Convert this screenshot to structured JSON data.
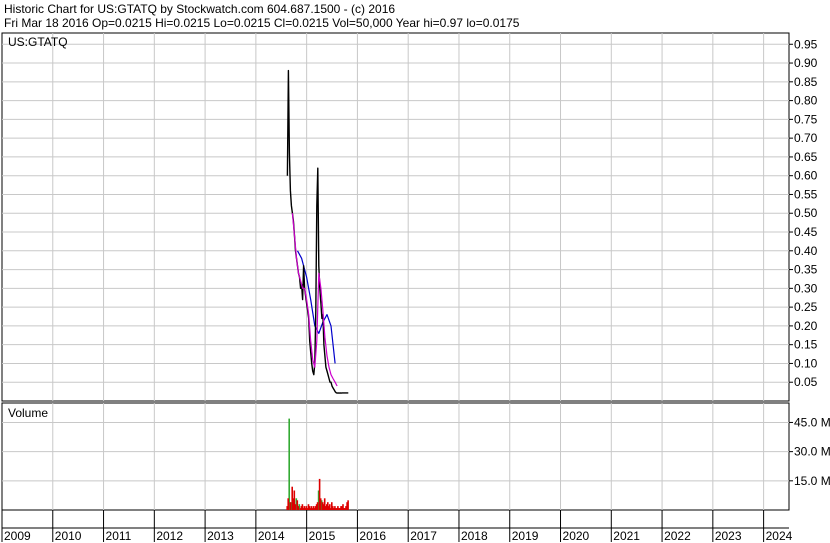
{
  "header": {
    "line1": "Historic Chart for US:GTATQ by Stockwatch.com 604.687.1500 - (c) 2016",
    "line2": "Fri Mar 18 2016   Op=0.0215   Hi=0.0215   Lo=0.0215   Cl=0.0215   Vol=50,000   Year hi=0.97   lo=0.0175"
  },
  "colors": {
    "price": "#000000",
    "ma_short": "#cc00cc",
    "ma_long": "#0000cc",
    "volume_up": "#33aa33",
    "volume_down": "#dd0000",
    "grid": "#c8c8c8",
    "frame": "#000000"
  },
  "chart_data": [
    {
      "type": "line",
      "title": "US:GTATQ",
      "y_ticks": [
        "0.95",
        "0.90",
        "0.85",
        "0.80",
        "0.75",
        "0.70",
        "0.65",
        "0.60",
        "0.55",
        "0.50",
        "0.45",
        "0.40",
        "0.35",
        "0.30",
        "0.25",
        "0.20",
        "0.15",
        "0.10",
        "0.05"
      ],
      "ylim": [
        0,
        0.98
      ],
      "xlim": [
        2009.0,
        2024.5
      ],
      "x_ticks": [
        "2009",
        "2010",
        "2011",
        "2012",
        "2013",
        "2014",
        "2015",
        "2016",
        "2017",
        "2018",
        "2019",
        "2020",
        "2021",
        "2022",
        "2023",
        "2024"
      ],
      "grid": true,
      "series": [
        {
          "key": "price",
          "x": [
            2014.62,
            2014.64,
            2014.66,
            2014.68,
            2014.7,
            2014.72,
            2014.74,
            2014.76,
            2014.78,
            2014.8,
            2014.82,
            2014.84,
            2014.86,
            2014.88,
            2014.9,
            2014.92,
            2014.94,
            2014.96,
            2014.98,
            2015.0,
            2015.02,
            2015.04,
            2015.06,
            2015.08,
            2015.1,
            2015.12,
            2015.14,
            2015.16,
            2015.18,
            2015.2,
            2015.22,
            2015.24,
            2015.26,
            2015.28,
            2015.3,
            2015.32,
            2015.34,
            2015.36,
            2015.38,
            2015.4,
            2015.42,
            2015.44,
            2015.46,
            2015.48,
            2015.5,
            2015.52,
            2015.54,
            2015.56,
            2015.58,
            2015.6,
            2015.62,
            2015.64,
            2015.66,
            2015.68,
            2015.7,
            2015.72,
            2015.74,
            2015.76,
            2015.78,
            2015.8,
            2015.82
          ],
          "y": [
            0.6,
            0.88,
            0.66,
            0.56,
            0.52,
            0.5,
            0.48,
            0.44,
            0.4,
            0.38,
            0.36,
            0.34,
            0.33,
            0.3,
            0.31,
            0.27,
            0.36,
            0.3,
            0.28,
            0.26,
            0.24,
            0.22,
            0.16,
            0.13,
            0.1,
            0.08,
            0.07,
            0.1,
            0.24,
            0.52,
            0.62,
            0.36,
            0.3,
            0.26,
            0.22,
            0.23,
            0.15,
            0.12,
            0.09,
            0.08,
            0.07,
            0.06,
            0.05,
            0.05,
            0.04,
            0.035,
            0.03,
            0.025,
            0.022,
            0.021,
            0.0215,
            0.021,
            0.0215,
            0.021,
            0.0215,
            0.0215,
            0.0215,
            0.0215,
            0.0215,
            0.0215,
            0.0215
          ]
        },
        {
          "key": "ma_short",
          "x": [
            2014.72,
            2014.76,
            2014.8,
            2014.84,
            2014.88,
            2014.92,
            2014.96,
            2015.0,
            2015.04,
            2015.08,
            2015.12,
            2015.16,
            2015.2,
            2015.24,
            2015.28,
            2015.32,
            2015.36,
            2015.4,
            2015.44,
            2015.48,
            2015.52,
            2015.56,
            2015.6
          ],
          "y": [
            0.5,
            0.44,
            0.38,
            0.34,
            0.32,
            0.3,
            0.3,
            0.27,
            0.23,
            0.16,
            0.11,
            0.09,
            0.16,
            0.34,
            0.3,
            0.24,
            0.17,
            0.12,
            0.09,
            0.07,
            0.06,
            0.05,
            0.04
          ]
        },
        {
          "key": "ma_long",
          "x": [
            2014.82,
            2014.9,
            2015.0,
            2015.08,
            2015.16,
            2015.24,
            2015.32,
            2015.4,
            2015.48,
            2015.56
          ],
          "y": [
            0.4,
            0.38,
            0.33,
            0.27,
            0.2,
            0.18,
            0.21,
            0.23,
            0.2,
            0.1
          ]
        }
      ]
    },
    {
      "type": "bar",
      "title": "Volume",
      "y_ticks": [
        "45.0 M",
        "30.0 M",
        "15.0 M"
      ],
      "ylim": [
        0,
        55000000
      ],
      "xlim": [
        2009.0,
        2024.5
      ],
      "grid": true,
      "series": [
        {
          "key": "volume_up",
          "x": [
            2014.66,
            2014.7,
            2014.8,
            2014.86,
            2015.24,
            2015.3
          ],
          "values": [
            47000000,
            4000000,
            6000000,
            3000000,
            10000000,
            5000000
          ]
        },
        {
          "key": "volume_down",
          "x": [
            2014.62,
            2014.64,
            2014.68,
            2014.72,
            2014.74,
            2014.76,
            2014.78,
            2014.82,
            2014.84,
            2014.88,
            2014.9,
            2014.92,
            2014.94,
            2014.96,
            2014.98,
            2015.0,
            2015.02,
            2015.04,
            2015.06,
            2015.08,
            2015.1,
            2015.12,
            2015.14,
            2015.16,
            2015.18,
            2015.2,
            2015.22,
            2015.26,
            2015.28,
            2015.32,
            2015.34,
            2015.36,
            2015.38,
            2015.4,
            2015.42,
            2015.44,
            2015.46,
            2015.48,
            2015.5,
            2015.52,
            2015.54,
            2015.56,
            2015.58,
            2015.6,
            2015.62,
            2015.64,
            2015.66,
            2015.68,
            2015.7,
            2015.72,
            2015.74,
            2015.76,
            2015.78,
            2015.8,
            2015.82
          ],
          "values": [
            2000000,
            6000000,
            4000000,
            12000000,
            6000000,
            10000000,
            3000000,
            5000000,
            2000000,
            1000000,
            2000000,
            3000000,
            1000000,
            2000000,
            1000000,
            2000000,
            1000000,
            3000000,
            2000000,
            1000000,
            2000000,
            1000000,
            2000000,
            1000000,
            2000000,
            3000000,
            4000000,
            16000000,
            6000000,
            4000000,
            3000000,
            6000000,
            2000000,
            3000000,
            4000000,
            2000000,
            3000000,
            1000000,
            4000000,
            2000000,
            1000000,
            2000000,
            1000000,
            1000000,
            2000000,
            1000000,
            1000000,
            2000000,
            2000000,
            3000000,
            1000000,
            1000000,
            2000000,
            4000000,
            5000000
          ]
        }
      ]
    }
  ]
}
